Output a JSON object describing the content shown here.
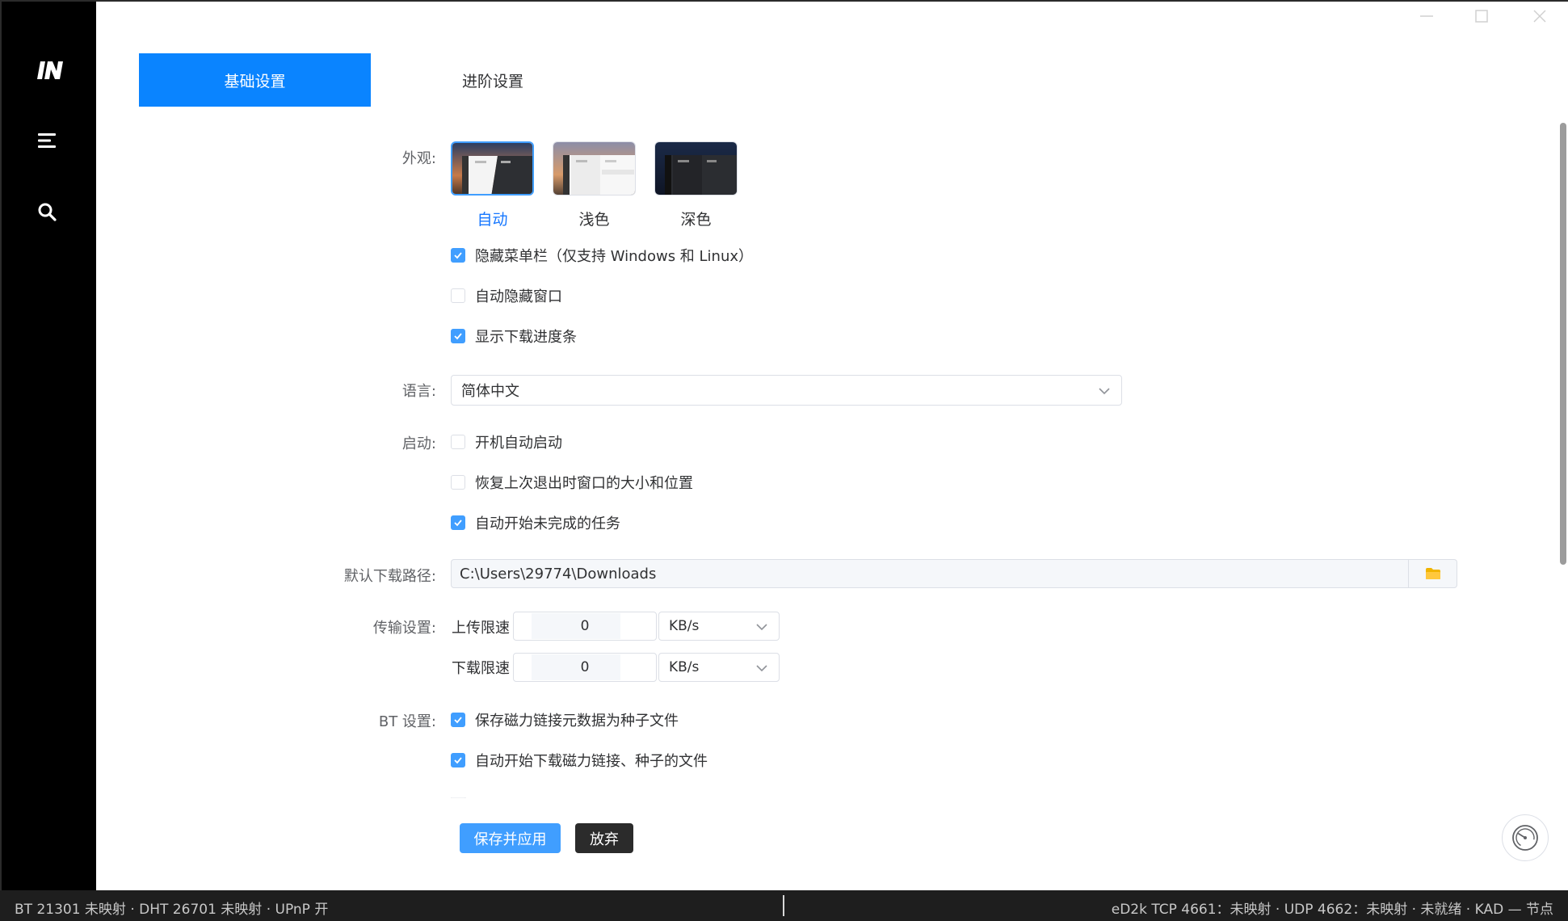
{
  "sidebar": {
    "logo": "IN",
    "menu_icon": "menu-icon",
    "search_icon": "search-icon"
  },
  "tabs": [
    {
      "label": "基础设置",
      "active": true
    },
    {
      "label": "进阶设置",
      "active": false
    }
  ],
  "appearance": {
    "label": "外观:",
    "options": [
      {
        "label": "自动",
        "selected": true
      },
      {
        "label": "浅色",
        "selected": false
      },
      {
        "label": "深色",
        "selected": false
      }
    ],
    "checkboxes": [
      {
        "label": "隐藏菜单栏（仅支持 Windows 和 Linux）",
        "checked": true
      },
      {
        "label": "自动隐藏窗口",
        "checked": false
      },
      {
        "label": "显示下载进度条",
        "checked": true
      }
    ]
  },
  "language": {
    "label": "语言:",
    "value": "简体中文"
  },
  "startup": {
    "label": "启动:",
    "checkboxes": [
      {
        "label": "开机自动启动",
        "checked": false
      },
      {
        "label": "恢复上次退出时窗口的大小和位置",
        "checked": false
      },
      {
        "label": "自动开始未完成的任务",
        "checked": true
      }
    ]
  },
  "download_path": {
    "label": "默认下载路径:",
    "value": "C:\\Users\\29774\\Downloads",
    "folder_icon": "folder-icon"
  },
  "transfer": {
    "label": "传输设置:",
    "upload_label": "上传限速",
    "upload_value": "0",
    "upload_unit": "KB/s",
    "download_label": "下载限速",
    "download_value": "0",
    "download_unit": "KB/s"
  },
  "bt": {
    "label": "BT 设置:",
    "checkboxes": [
      {
        "label": "保存磁力链接元数据为种子文件",
        "checked": true
      },
      {
        "label": "自动开始下载磁力链接、种子的文件",
        "checked": true
      }
    ]
  },
  "actions": {
    "save": "保存并应用",
    "discard": "放弃"
  },
  "statusbar": {
    "left": "BT 21301 未映射 · DHT 26701 未映射 · UPnP 开",
    "right": "eD2k TCP 4661：未映射 · UDP 4662：未映射 · 未就绪 · KAD — 节点"
  },
  "colors": {
    "accent": "#409eff",
    "tab_active": "#0a84ff",
    "sidebar": "#000000",
    "statusbar": "#1e1e1e"
  }
}
